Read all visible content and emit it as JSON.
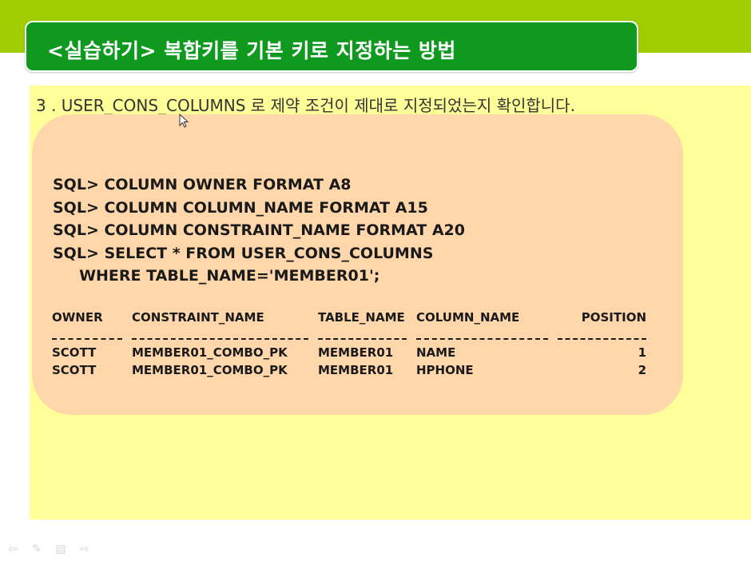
{
  "slide": {
    "title": "<실습하기> 복합키를 기본 키로 지정하는 방법",
    "instruction": "3 . USER_CONS_COLUMNS 로 제약 조건이 제대로 지정되었는지 확인합니다."
  },
  "sql": {
    "lines": [
      "SQL> COLUMN OWNER FORMAT A8",
      "SQL> COLUMN COLUMN_NAME FORMAT A15",
      "SQL> COLUMN CONSTRAINT_NAME FORMAT A20",
      "SQL> SELECT * FROM USER_CONS_COLUMNS",
      "     WHERE TABLE_NAME='MEMBER01';"
    ]
  },
  "result": {
    "columns": [
      "OWNER",
      "CONSTRAINT_NAME",
      "TABLE_NAME",
      "COLUMN_NAME",
      "POSITION"
    ],
    "rows": [
      [
        "SCOTT",
        "MEMBER01_COMBO_PK",
        "MEMBER01",
        "NAME",
        "1"
      ],
      [
        "SCOTT",
        "MEMBER01_COMBO_PK",
        "MEMBER01",
        "HPHONE",
        "2"
      ]
    ]
  },
  "colors": {
    "top_band": "#9fce00",
    "title_bar": "#0f9a1f",
    "content_bg": "#ffff99",
    "code_box": "#ffd7aa"
  },
  "controls": [
    {
      "icon": "previous-arrow-icon",
      "glyph": "⇦"
    },
    {
      "icon": "pen-icon",
      "glyph": "✎"
    },
    {
      "icon": "menu-icon",
      "glyph": "▤"
    },
    {
      "icon": "next-arrow-icon",
      "glyph": "⇨"
    }
  ]
}
